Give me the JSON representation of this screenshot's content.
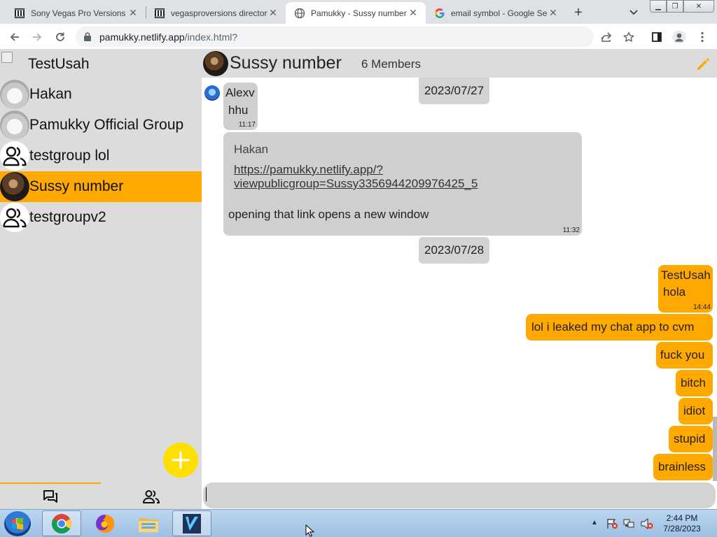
{
  "browser": {
    "tabs": [
      {
        "title": "Sony Vegas Pro Versions",
        "favicon": "institution-icon",
        "active": false
      },
      {
        "title": "vegasproversions directory",
        "favicon": "institution-icon",
        "active": false
      },
      {
        "title": "Pamukky - Sussy number",
        "favicon": "globe-icon",
        "active": true
      },
      {
        "title": "email symbol - Google Search",
        "favicon": "google-icon",
        "active": false
      }
    ],
    "url": {
      "host": "pamukky.netlify.app",
      "path": "/index.html?"
    }
  },
  "sidebar": {
    "current_user": "TestUsah",
    "chats": [
      {
        "name": "Hakan",
        "avatar": "cat-avatar",
        "selected": false
      },
      {
        "name": "Pamukky Official Group",
        "avatar": "cat-avatar",
        "selected": false
      },
      {
        "name": "testgroup lol",
        "avatar": "group-icon",
        "selected": false
      },
      {
        "name": "Sussy number",
        "avatar": "dark-cat-avatar",
        "selected": true
      },
      {
        "name": "testgroupv2",
        "avatar": "group-icon",
        "selected": false
      }
    ],
    "bottom_tabs": [
      "chats-icon",
      "contacts-icon"
    ]
  },
  "chat": {
    "title": "Sussy number",
    "members": "6 Members",
    "messages": [
      {
        "kind": "date",
        "text": "2023/07/27"
      },
      {
        "kind": "incoming",
        "sender": "Alexv",
        "text": "hhu",
        "time": "11:17"
      },
      {
        "kind": "incoming",
        "sender": "Hakan",
        "link": "https://pamukky.netlify.app/?viewpublicgroup=Sussy3356944209976425_5",
        "link_line1": "https://pamukky.netlify.app/?",
        "link_line2": "viewpublicgroup=Sussy3356944209976425_5",
        "text": "opening that link opens a new window",
        "time": "11:32"
      },
      {
        "kind": "date",
        "text": "2023/07/28"
      },
      {
        "kind": "outgoing",
        "sender": "TestUsah",
        "text": "hola",
        "time": "14:44"
      },
      {
        "kind": "outgoing",
        "text": "lol i leaked my chat app to cvm"
      },
      {
        "kind": "outgoing",
        "text": "fuck you"
      },
      {
        "kind": "outgoing",
        "text": "bitch"
      },
      {
        "kind": "outgoing",
        "text": "idiot"
      },
      {
        "kind": "outgoing",
        "text": "stupid"
      },
      {
        "kind": "outgoing",
        "text": "brainless"
      }
    ],
    "composer": {
      "value": ""
    }
  },
  "taskbar": {
    "apps": [
      "start-orb",
      "chrome-icon",
      "firefox-icon",
      "file-explorer-icon",
      "vegas-icon"
    ],
    "clock": {
      "time": "2:44 PM",
      "date": "7/28/2023"
    }
  },
  "colors": {
    "accent": "#ffa800",
    "fab": "#ffdf00",
    "panel": "#dcdcdc",
    "bubble_in": "#cfcfcf"
  }
}
